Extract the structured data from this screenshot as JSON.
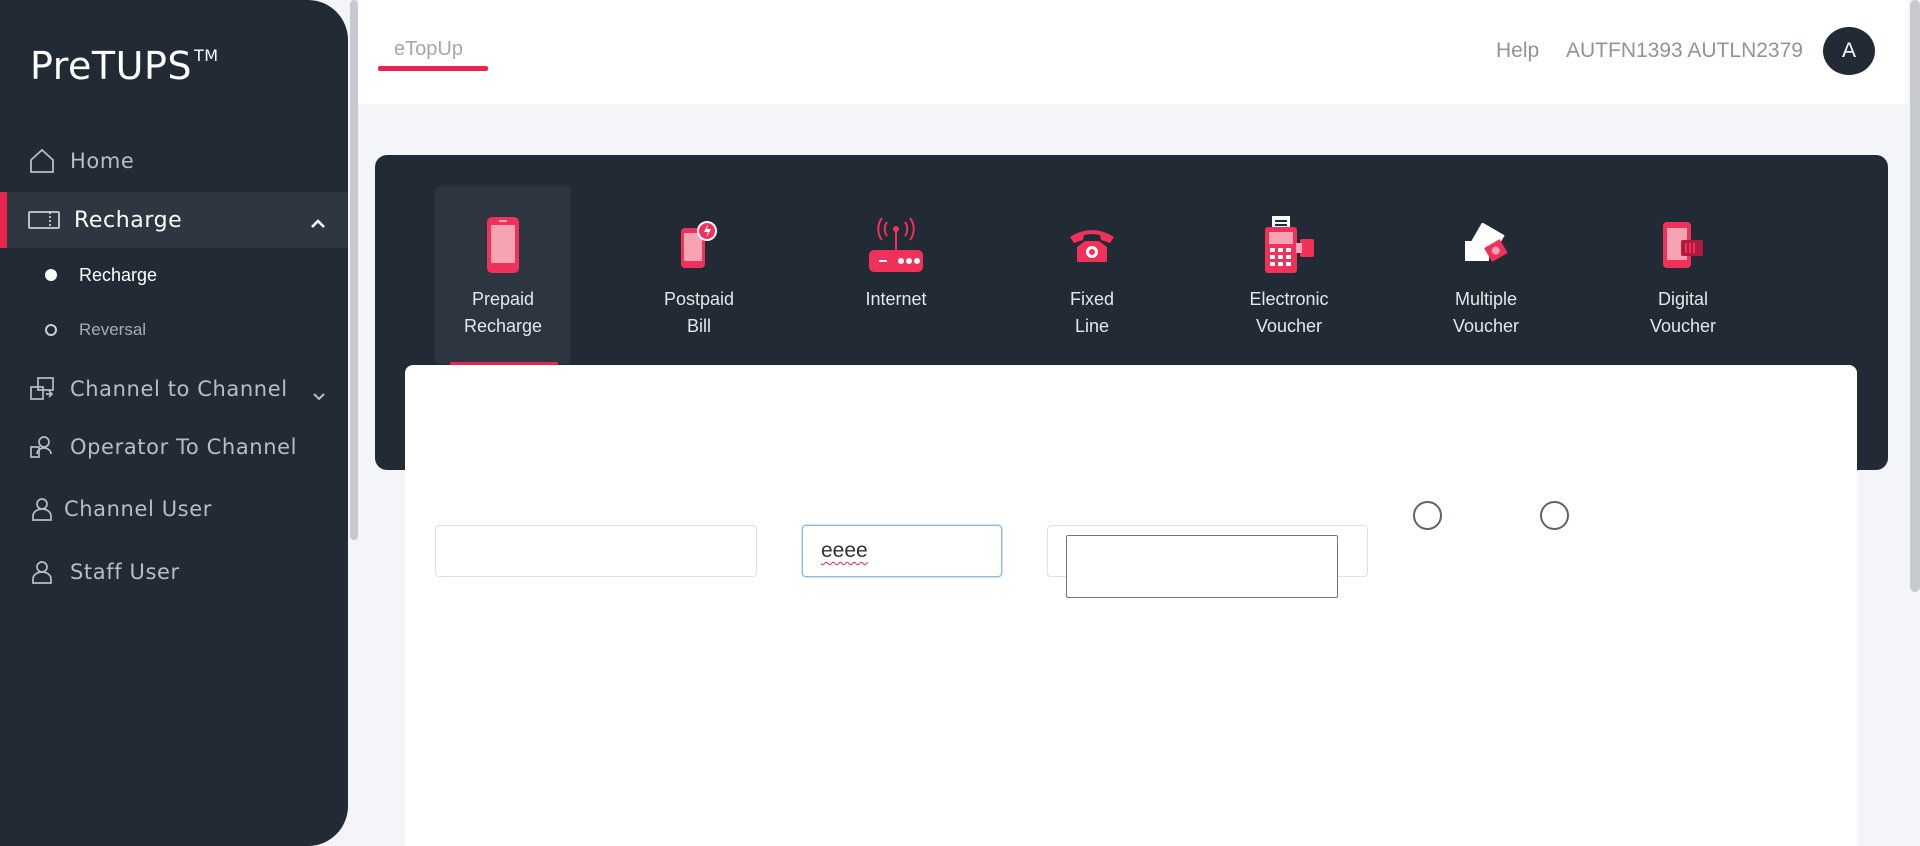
{
  "brand": {
    "name": "PreTUPS",
    "tm": "TM"
  },
  "sidebar": {
    "items": [
      {
        "label": "Home",
        "icon": "home-icon"
      },
      {
        "label": "Recharge",
        "icon": "ticket-icon",
        "active": true
      },
      {
        "label": "Channel to Channel",
        "icon": "transfer-icon"
      },
      {
        "label": "Operator To Channel",
        "icon": "operator-transfer-icon"
      },
      {
        "label": "Channel User",
        "icon": "user-icon"
      },
      {
        "label": "Staff User",
        "icon": "user-icon"
      }
    ],
    "sub_items": [
      {
        "label": "Recharge",
        "selected": true
      },
      {
        "label": "Reversal",
        "selected": false
      }
    ]
  },
  "topbar": {
    "tab": "eTopUp",
    "help": "Help",
    "user_name": "AUTFN1393 AUTLN2379",
    "avatar_initial": "A"
  },
  "services": [
    {
      "label_line1": "Prepaid",
      "label_line2": "Recharge",
      "icon": "mobile-phone-icon",
      "selected": true
    },
    {
      "label_line1": "Postpaid",
      "label_line2": "Bill",
      "icon": "postpaid-phone-icon"
    },
    {
      "label_line1": "Internet",
      "label_line2": "",
      "icon": "router-icon"
    },
    {
      "label_line1": "Fixed",
      "label_line2": "Line",
      "icon": "telephone-icon"
    },
    {
      "label_line1": "Electronic",
      "label_line2": "Voucher",
      "icon": "pos-terminal-icon"
    },
    {
      "label_line1": "Multiple",
      "label_line2": "Voucher",
      "icon": "vouchers-icon"
    },
    {
      "label_line1": "Digital",
      "label_line2": "Voucher",
      "icon": "digital-voucher-icon"
    }
  ],
  "form": {
    "field1_value": "",
    "field2_value": "eeee",
    "field3_value": ""
  },
  "colors": {
    "accent": "#e8254f",
    "sidebar_bg": "#222a35"
  }
}
